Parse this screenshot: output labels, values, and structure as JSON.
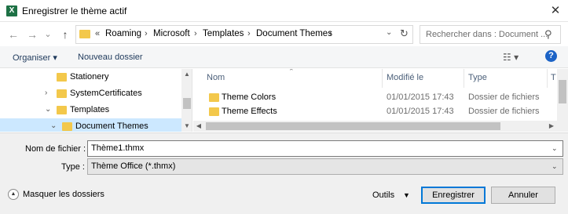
{
  "window": {
    "title": "Enregistrer le thème actif",
    "app_icon_letter": "X",
    "close_glyph": "✕"
  },
  "nav": {
    "back_glyph": "←",
    "forward_glyph": "→",
    "recent_glyph": "⌄",
    "up_glyph": "↑",
    "address": {
      "overflow": "«",
      "segments": [
        "Roaming",
        "Microsoft",
        "Templates",
        "Document Themes"
      ],
      "separator": "›"
    },
    "search_placeholder": "Rechercher dans : Document ..."
  },
  "toolbar": {
    "organize_label": "Organiser ▾",
    "new_folder_label": "Nouveau dossier",
    "view_glyph": "☷ ▾",
    "help_glyph": "?"
  },
  "tree": {
    "items": [
      {
        "label": "Stationery",
        "chevron": "",
        "selected": false
      },
      {
        "label": "SystemCertificates",
        "chevron": "›",
        "selected": false
      },
      {
        "label": "Templates",
        "chevron": "⌄",
        "selected": false
      },
      {
        "label": "Document Themes",
        "chevron": "⌄",
        "selected": true
      }
    ]
  },
  "filelist": {
    "columns": [
      "Nom",
      "Modifié le",
      "Type",
      "T"
    ],
    "rows": [
      {
        "name": "Theme Colors",
        "modified": "01/01/2015 17:43",
        "type": "Dossier de fichiers"
      },
      {
        "name": "Theme Effects",
        "modified": "01/01/2015 17:43",
        "type": "Dossier de fichiers"
      }
    ]
  },
  "form": {
    "filename_label": "Nom de fichier :",
    "filename_value": "Thème1.thmx",
    "type_label": "Type :",
    "type_value": "Thème Office (*.thmx)"
  },
  "footer": {
    "hide_folders_label": "Masquer les dossiers",
    "tools_label": "Outils",
    "save_label": "Enregistrer",
    "cancel_label": "Annuler"
  },
  "colors": {
    "accent": "#0078d7",
    "selection": "#cce8ff",
    "folder": "#f3c84b"
  }
}
